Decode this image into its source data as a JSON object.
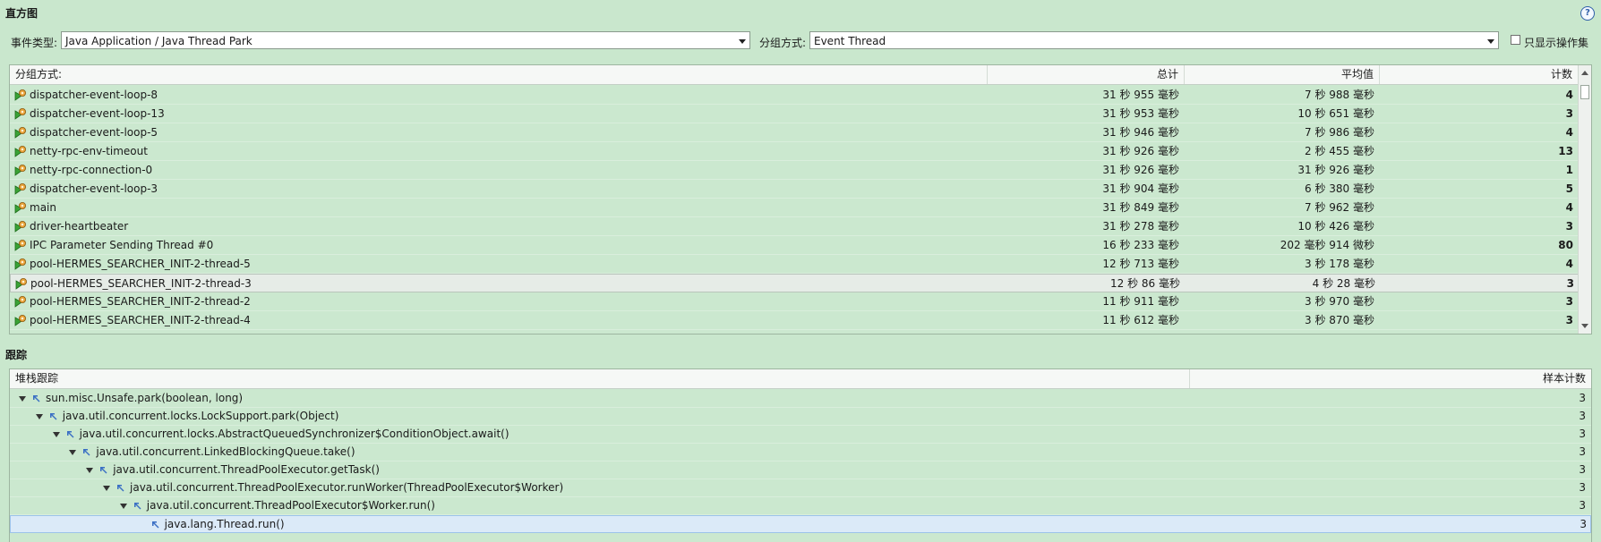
{
  "histogram": {
    "title": "直方图",
    "filters": {
      "event_type_label": "事件类型:",
      "event_type_value": "Java Application / Java Thread Park",
      "group_by_label": "分组方式:",
      "group_by_value": "Event Thread",
      "only_ops_label": "只显示操作集"
    },
    "columns": [
      "分组方式:",
      "总计",
      "平均值",
      "计数"
    ],
    "rows": [
      {
        "name": "dispatcher-event-loop-8",
        "total": "31 秒 955 毫秒",
        "avg": "7 秒 988 毫秒",
        "count": "4"
      },
      {
        "name": "dispatcher-event-loop-13",
        "total": "31 秒 953 毫秒",
        "avg": "10 秒 651 毫秒",
        "count": "3"
      },
      {
        "name": "dispatcher-event-loop-5",
        "total": "31 秒 946 毫秒",
        "avg": "7 秒 986 毫秒",
        "count": "4"
      },
      {
        "name": "netty-rpc-env-timeout",
        "total": "31 秒 926 毫秒",
        "avg": "2 秒 455 毫秒",
        "count": "13"
      },
      {
        "name": "netty-rpc-connection-0",
        "total": "31 秒 926 毫秒",
        "avg": "31 秒 926 毫秒",
        "count": "1"
      },
      {
        "name": "dispatcher-event-loop-3",
        "total": "31 秒 904 毫秒",
        "avg": "6 秒 380 毫秒",
        "count": "5"
      },
      {
        "name": "main",
        "total": "31 秒 849 毫秒",
        "avg": "7 秒 962 毫秒",
        "count": "4"
      },
      {
        "name": "driver-heartbeater",
        "total": "31 秒 278 毫秒",
        "avg": "10 秒 426 毫秒",
        "count": "3"
      },
      {
        "name": "IPC Parameter Sending Thread #0",
        "total": "16 秒 233 毫秒",
        "avg": "202 毫秒 914 微秒",
        "count": "80"
      },
      {
        "name": "pool-HERMES_SEARCHER_INIT-2-thread-5",
        "total": "12 秒 713 毫秒",
        "avg": "3 秒 178 毫秒",
        "count": "4"
      },
      {
        "name": "pool-HERMES_SEARCHER_INIT-2-thread-3",
        "total": "12 秒 86 毫秒",
        "avg": "4 秒 28 毫秒",
        "count": "3"
      },
      {
        "name": "pool-HERMES_SEARCHER_INIT-2-thread-2",
        "total": "11 秒 911 毫秒",
        "avg": "3 秒 970 毫秒",
        "count": "3"
      },
      {
        "name": "pool-HERMES_SEARCHER_INIT-2-thread-4",
        "total": "11 秒 612 毫秒",
        "avg": "3 秒 870 毫秒",
        "count": "3"
      }
    ],
    "selected_row": 10
  },
  "trace": {
    "title": "跟踪",
    "columns": [
      "堆栈跟踪",
      "样本计数"
    ],
    "rows": [
      {
        "frame": "sun.misc.Unsafe.park(boolean, long)",
        "count": "3"
      },
      {
        "frame": "java.util.concurrent.locks.LockSupport.park(Object)",
        "count": "3"
      },
      {
        "frame": "java.util.concurrent.locks.AbstractQueuedSynchronizer$ConditionObject.await()",
        "count": "3"
      },
      {
        "frame": "java.util.concurrent.LinkedBlockingQueue.take()",
        "count": "3"
      },
      {
        "frame": "java.util.concurrent.ThreadPoolExecutor.getTask()",
        "count": "3"
      },
      {
        "frame": "java.util.concurrent.ThreadPoolExecutor.runWorker(ThreadPoolExecutor$Worker)",
        "count": "3"
      },
      {
        "frame": "java.util.concurrent.ThreadPoolExecutor$Worker.run()",
        "count": "3"
      },
      {
        "frame": "java.lang.Thread.run()",
        "count": "3"
      }
    ],
    "selected_row": 7
  },
  "icons": {
    "help": "help-icon",
    "thread": "thread-icon",
    "frame": "stack-frame-icon",
    "expand": "expand-triangle-icon"
  }
}
